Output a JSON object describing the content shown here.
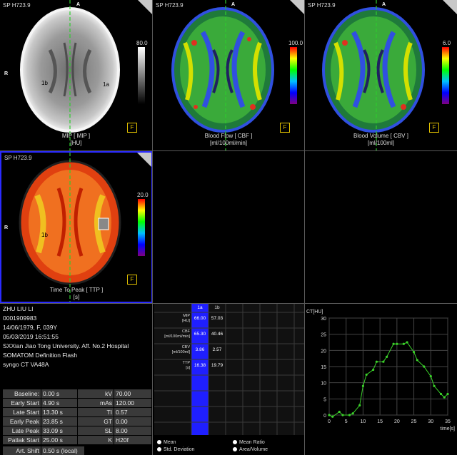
{
  "viewports": [
    {
      "label": "SP H723.9",
      "caption1": "MIP [ MIP ]",
      "caption2": "[HU]",
      "cbar_max": "80.0"
    },
    {
      "label": "SP H723.9",
      "caption1": "Blood Flow [ CBF ]",
      "caption2": "[ml/100ml/min]",
      "cbar_max": "100.0"
    },
    {
      "label": "SP H723.9",
      "caption1": "Blood Volume [ CBV ]",
      "caption2": "[ml/100ml]",
      "cbar_max": "6.0"
    },
    {
      "label": "SP H723.9",
      "caption1": "Time To Peak [ TTP ]",
      "caption2": "[s]",
      "cbar_max": "20.0"
    }
  ],
  "orientation": {
    "top": "A",
    "left": "R"
  },
  "roi": {
    "a": "1a",
    "b": "1b"
  },
  "fbox_label": "F",
  "patient": {
    "name": "ZHU LIU LI",
    "id": "0001909983",
    "dob": "14/06/1979, F, 039Y",
    "date": "05/03/2019 16:51:55",
    "institution": "SXXian Jiao Tong University. Aff. No.2 Hospital",
    "scanner": "SOMATOM Definition Flash",
    "software": "syngo CT VA48A"
  },
  "params": [
    {
      "l1": "Baseline:",
      "v1": "0.00 s",
      "l2": "kV",
      "v2": "70.00"
    },
    {
      "l1": "Early Start",
      "v1": "4.90 s",
      "l2": "mAs",
      "v2": "120.00"
    },
    {
      "l1": "Late Start",
      "v1": "13.30 s",
      "l2": "TI",
      "v2": "0.57"
    },
    {
      "l1": "Early Peak",
      "v1": "23.85 s",
      "l2": "GT",
      "v2": "0.00"
    },
    {
      "l1": "Late Peak",
      "v1": "33.09 s",
      "l2": "SL",
      "v2": "8.00"
    },
    {
      "l1": "Patlak Start",
      "v1": "25.00 s",
      "l2": "K",
      "v2": "H20f"
    }
  ],
  "art_shift": {
    "label": "Art. Shift",
    "value": "0.50 s (local)"
  },
  "table": {
    "cols": [
      "1a",
      "1b"
    ],
    "rows": [
      {
        "label": "MIP\n[HU]",
        "v1": "66.00",
        "v2": "57.03"
      },
      {
        "label": "CBF\n[ml/100ml/min]",
        "v1": "65.30",
        "v2": "40.46"
      },
      {
        "label": "CBV\n[ml/100ml]",
        "v1": "3.86",
        "v2": "2.57"
      },
      {
        "label": "TTP\n[s]",
        "v1": "16.38",
        "v2": "19.79"
      }
    ],
    "legend": [
      "Mean",
      "Std. Deviation",
      "Mean Ratio",
      "Area/Volume"
    ]
  },
  "chart_data": {
    "type": "line",
    "title": "",
    "ylabel": "CT[HU]",
    "xlabel": "time[s]",
    "xlim": [
      0,
      35
    ],
    "ylim": [
      0,
      30
    ],
    "xticks": [
      0,
      5,
      10,
      15,
      20,
      25,
      30,
      35
    ],
    "yticks": [
      0,
      5,
      10,
      15,
      20,
      25,
      30
    ],
    "series": [
      {
        "color": "#3bd12a",
        "x": [
          0,
          1,
          3,
          4,
          6,
          7,
          9,
          10,
          11,
          13,
          14,
          16,
          17,
          19,
          20,
          22,
          23,
          25,
          26,
          28,
          30,
          31,
          33,
          34,
          35
        ],
        "y": [
          0,
          -0.5,
          1,
          0,
          0,
          0.5,
          3,
          9,
          12.5,
          14,
          16.5,
          16.5,
          18,
          22,
          22,
          22,
          22.5,
          19.5,
          17,
          15,
          12,
          9,
          6.5,
          5.5,
          6.5
        ]
      }
    ],
    "grid": true
  },
  "colors": {
    "selected_border": "#2a2aff",
    "highlight_col": "#1f1fff",
    "line": "#3bd12a"
  }
}
